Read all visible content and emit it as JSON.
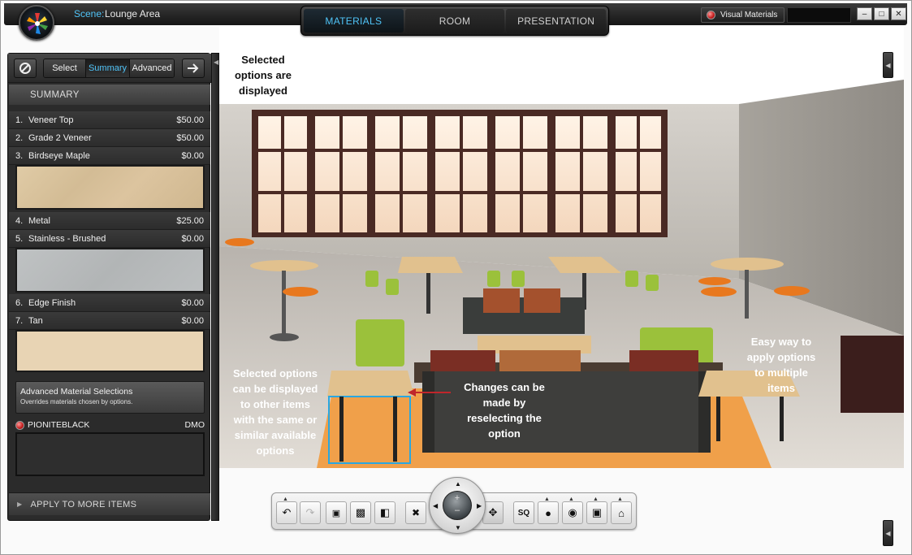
{
  "header": {
    "scene_label": "Scene:",
    "scene_name": "Lounge Area",
    "tabs": [
      {
        "label": "MATERIALS",
        "active": true
      },
      {
        "label": "ROOM",
        "active": false
      },
      {
        "label": "PRESENTATION",
        "active": false
      }
    ],
    "visual_materials_label": "Visual Materials",
    "window_controls": [
      "minimize-icon",
      "maximize-icon",
      "close-icon"
    ]
  },
  "panel": {
    "toolbar": {
      "segments": [
        {
          "label": "Select",
          "active": false
        },
        {
          "label": "Summary",
          "active": true
        },
        {
          "label": "Advanced",
          "active": false
        }
      ]
    },
    "summary_title": "SUMMARY",
    "options": [
      {
        "num": "1.",
        "label": "Veneer Top",
        "price": "$50.00"
      },
      {
        "num": "2.",
        "label": "Grade 2 Veneer",
        "price": "$50.00"
      },
      {
        "num": "3.",
        "label": "Birdseye Maple",
        "price": "$0.00"
      },
      {
        "num": "4.",
        "label": "Metal",
        "price": "$25.00"
      },
      {
        "num": "5.",
        "label": "Stainless - Brushed",
        "price": "$0.00"
      },
      {
        "num": "6.",
        "label": "Edge Finish",
        "price": "$0.00"
      },
      {
        "num": "7.",
        "label": "Tan",
        "price": "$0.00"
      }
    ],
    "swatch_colors": {
      "birdseye_maple": "#d8c3a0",
      "stainless_brushed": "#b9bcbd",
      "tan": "#e8d4b4"
    },
    "advanced": {
      "title": "Advanced Material Selections",
      "subtitle": "Overrides materials chosen by options."
    },
    "material_name": "PIONITEBLACK",
    "material_code": "DMO",
    "apply_label": "APPLY TO MORE ITEMS"
  },
  "annotations": {
    "selected_displayed": "Selected\noptions are\ndisplayed",
    "other_items": "Selected options\ncan be displayed\nto other items\nwith the same or\nsimilar available\noptions",
    "reselect": "Changes can be\nmade by\nreselecting the\noption",
    "multiple": "Easy way to\napply options\nto multiple\nitems"
  },
  "toolbar_bottom": {
    "sq_label": "SQ",
    "nav_plus": "+",
    "nav_minus": "–"
  },
  "colors": {
    "accent": "#4fc3f7",
    "arrow": "#c0262b",
    "floor_rug": "#f0a04a"
  }
}
